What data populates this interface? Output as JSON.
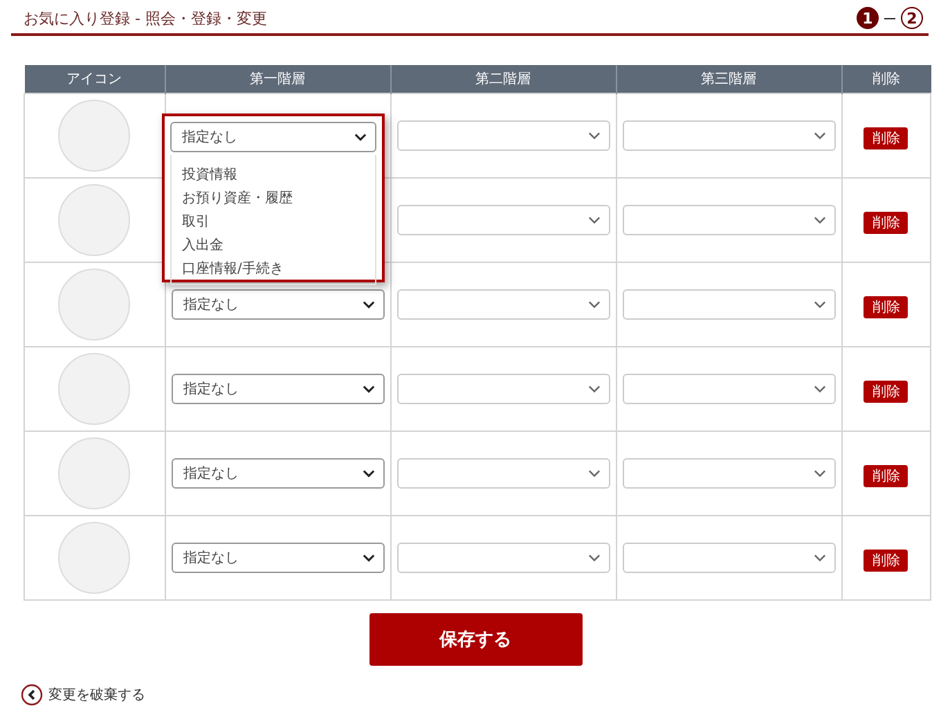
{
  "page_title": "お気に入り登録 - 照会・登録・変更",
  "steps": [
    {
      "label": "1",
      "selected": true
    },
    {
      "label": "2",
      "selected": false
    }
  ],
  "table": {
    "columns": [
      "アイコン",
      "第一階層",
      "第二階層",
      "第三階層",
      "削除"
    ],
    "rows": [
      {
        "first_level": "指定なし",
        "delete": "削除",
        "open": true
      },
      {
        "delete": "削除",
        "open": false
      },
      {
        "first_level": "指定なし",
        "delete": "削除",
        "open": false
      },
      {
        "first_level": "指定なし",
        "delete": "削除",
        "open": false
      },
      {
        "first_level": "指定なし",
        "delete": "削除",
        "open": false
      },
      {
        "first_level": "指定なし",
        "delete": "削除",
        "open": false
      }
    ]
  },
  "dropdown_options": [
    "投資情報",
    "お預り資産・履歴",
    "取引",
    "入出金",
    "口座情報/手続き"
  ],
  "save_button": "保存する",
  "back_link": "変更を破棄する"
}
